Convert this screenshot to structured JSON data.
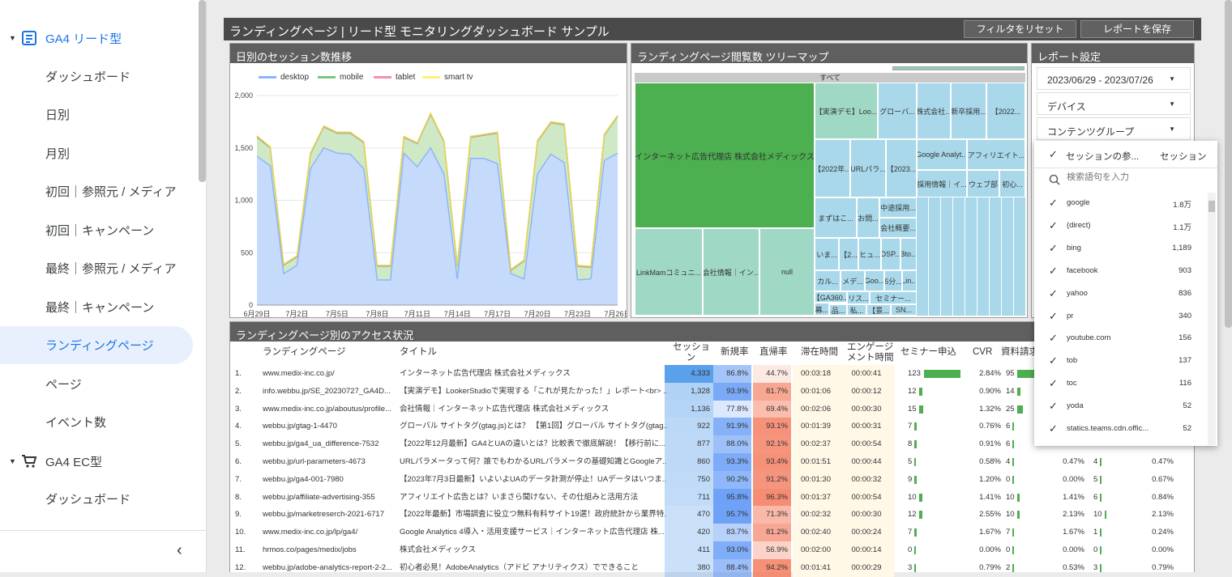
{
  "sidebar": {
    "group1": "GA4 リード型",
    "group2": "GA4 EC型",
    "items": [
      "ダッシュボード",
      "日別",
      "月別",
      "初回｜参照元 / メディア",
      "初回｜キャンペーン",
      "最終｜参照元 / メディア",
      "最終｜キャンペーン",
      "ランディングページ",
      "ページ",
      "イベント数"
    ],
    "items2": [
      "ダッシュボード"
    ]
  },
  "report": {
    "title": "ランディングページ | リード型 モニタリングダッシュボード サンプル",
    "reset_btn": "フィルタをリセット",
    "save_btn": "レポートを保存"
  },
  "line_panel": {
    "title": "日別のセッション数推移",
    "legend": [
      {
        "name": "desktop",
        "color": "#8ab4f8"
      },
      {
        "name": "mobile",
        "color": "#7bc67e"
      },
      {
        "name": "tablet",
        "color": "#f48fb1"
      },
      {
        "name": "smart tv",
        "color": "#fff176"
      }
    ]
  },
  "chart_data": {
    "type": "area",
    "x": [
      "6月29日",
      "6月30日",
      "7月1日",
      "7月2日",
      "7月3日",
      "7月4日",
      "7月5日",
      "7月6日",
      "7月7日",
      "7月8日",
      "7月9日",
      "7月10日",
      "7月11日",
      "7月12日",
      "7月13日",
      "7月14日",
      "7月15日",
      "7月16日",
      "7月17日",
      "7月18日",
      "7月19日",
      "7月20日",
      "7月21日",
      "7月22日",
      "7月23日",
      "7月24日",
      "7月25日",
      "7月26日"
    ],
    "xticks": [
      "6月29日",
      "7月2日",
      "7月5日",
      "7月8日",
      "7月11日",
      "7月14日",
      "7月17日",
      "7月20日",
      "7月23日",
      "7月26日"
    ],
    "yticks": [
      "0",
      "500",
      "1,000",
      "1,500",
      "2,000"
    ],
    "ylim": [
      0,
      2000
    ],
    "series": [
      {
        "name": "desktop",
        "values": [
          1420,
          1330,
          300,
          380,
          1300,
          1500,
          1450,
          1440,
          1300,
          240,
          240,
          1450,
          1320,
          1500,
          1250,
          250,
          1400,
          1400,
          1350,
          300,
          250,
          1250,
          1440,
          1360,
          240,
          250,
          1380,
          1450
        ]
      },
      {
        "name": "mobile",
        "values": [
          1600,
          1500,
          380,
          460,
          1440,
          1700,
          1640,
          1640,
          1550,
          370,
          370,
          1600,
          1540,
          1820,
          1560,
          370,
          1600,
          1620,
          1640,
          330,
          420,
          1560,
          1740,
          1720,
          370,
          360,
          1620,
          1800
        ]
      },
      {
        "name": "tablet",
        "values": [
          1610,
          1505,
          385,
          465,
          1445,
          1705,
          1645,
          1645,
          1555,
          375,
          375,
          1605,
          1545,
          1825,
          1565,
          375,
          1605,
          1625,
          1645,
          335,
          425,
          1565,
          1745,
          1725,
          375,
          365,
          1625,
          1805
        ]
      },
      {
        "name": "smart tv",
        "values": [
          1615,
          1510,
          390,
          470,
          1450,
          1710,
          1650,
          1650,
          1560,
          380,
          380,
          1610,
          1550,
          1830,
          1570,
          380,
          1610,
          1630,
          1650,
          340,
          430,
          1570,
          1750,
          1730,
          380,
          370,
          1630,
          1810
        ]
      }
    ]
  },
  "treemap": {
    "title": "ランディングページ閲覧数 ツリーマップ",
    "root": "すべて",
    "labels": {
      "big": "インターネット広告代理店 株式会社メディックス",
      "r1": "LinkMamコミュニ...",
      "r2": "会社情報｜イン...",
      "r3": "null",
      "a1": "【実演デモ】Loo...",
      "a2": "グローバ...",
      "a3": "株式会社...",
      "a4": "新卒採用...",
      "a5": "【2022...",
      "b1": "【2022年...",
      "b2": "URLパラ...",
      "b3": "【2023...",
      "b4": "Google Analyt...",
      "b5": "アフィリエイト...",
      "b6": "採用情報｜イ...",
      "b7": "ウェブ部",
      "b8": "初心...",
      "c1": "まずはこ...",
      "c2": "お問...",
      "c3": "中途採用...",
      "c4": "会社概要...",
      "c5": "いま...",
      "c6": "【2...",
      "c7": "ヒュ...",
      "c8": "DSP...",
      "c9": "Bto...",
      "c10": "カル...",
      "c11": "メデ...",
      "c12": "Goo...",
      "c13": "5分...",
      "c14": "Lin...",
      "c15": "【GA360...",
      "c16": "リス...",
      "c17": "セミナー...",
      "c18": "募...",
      "c19": "品...",
      "c20": "私...",
      "c21": "【景...",
      "c22": "SN..."
    }
  },
  "settings": {
    "title": "レポート設定",
    "date": "2023/06/29 - 2023/07/26",
    "device": "デバイス",
    "content_group": "コンテンツグループ"
  },
  "popup": {
    "col1": "セッションの参...",
    "col2": "セッション",
    "search_placeholder": "検索語句を入力",
    "rows": [
      {
        "name": "google",
        "value": "1.8万"
      },
      {
        "name": "(direct)",
        "value": "1.1万"
      },
      {
        "name": "bing",
        "value": "1,189"
      },
      {
        "name": "facebook",
        "value": "903"
      },
      {
        "name": "yahoo",
        "value": "836"
      },
      {
        "name": "pr",
        "value": "340"
      },
      {
        "name": "youtube.com",
        "value": "156"
      },
      {
        "name": "tob",
        "value": "137"
      },
      {
        "name": "toc",
        "value": "116"
      },
      {
        "name": "yoda",
        "value": "52"
      },
      {
        "name": "statics.teams.cdn.offic...",
        "value": "52"
      }
    ]
  },
  "table": {
    "title": "ランディングページ別のアクセス状況",
    "headers": {
      "lp": "ランディングページ",
      "title": "タイトル",
      "sessions": "セッショ\nン",
      "new": "新規率",
      "bounce": "直帰率",
      "stay": "滞在時間",
      "eng": "エンゲージ\nメント時間",
      "seminar": "セミナー申込",
      "cvr": "CVR",
      "doc": "資料請求"
    },
    "rows": [
      {
        "n": "1.",
        "lp": "www.medix-inc.co.jp/",
        "title": "インターネット広告代理店 株式会社メディックス",
        "s": "4,333",
        "nr": "86.8%",
        "br": "44.7%",
        "st": "00:03:18",
        "et": "00:00:41",
        "sem": "123",
        "cvr": "2.84%",
        "doc": "95",
        "x1": "",
        "x2": "",
        "x3": ""
      },
      {
        "n": "2.",
        "lp": "info.webbu.jp/SE_20230727_GA4D...",
        "title": "【実演デモ】LookerStudioで実現する「これが見たかった！」レポート<br> ...",
        "s": "1,328",
        "nr": "93.9%",
        "br": "81.7%",
        "st": "00:01:06",
        "et": "00:00:12",
        "sem": "12",
        "cvr": "0.90%",
        "doc": "14",
        "x1": "",
        "x2": "",
        "x3": ""
      },
      {
        "n": "3.",
        "lp": "www.medix-inc.co.jp/aboutus/profile...",
        "title": "会社情報｜インターネット広告代理店 株式会社メディックス",
        "s": "1,136",
        "nr": "77.8%",
        "br": "69.4%",
        "st": "00:02:06",
        "et": "00:00:30",
        "sem": "15",
        "cvr": "1.32%",
        "doc": "25",
        "x1": "",
        "x2": "",
        "x3": ""
      },
      {
        "n": "4.",
        "lp": "webbu.jp/gtag-1-4470",
        "title": "グローバル サイトタグ(gtag.js)とは？ 【第1回】グローバル サイトタグ(gtag...",
        "s": "922",
        "nr": "91.9%",
        "br": "93.1%",
        "st": "00:01:39",
        "et": "00:00:31",
        "sem": "7",
        "cvr": "0.76%",
        "doc": "6",
        "x1": "",
        "x2": "",
        "x3": ""
      },
      {
        "n": "5.",
        "lp": "webbu.jp/ga4_ua_difference-7532",
        "title": "【2022年12月最新】GA4とUAの違いとは？比較表で徹底解説！【移行前に...",
        "s": "877",
        "nr": "88.0%",
        "br": "92.1%",
        "st": "00:02:37",
        "et": "00:00:54",
        "sem": "8",
        "cvr": "0.91%",
        "doc": "6",
        "x1": "",
        "x2": "",
        "x3": ""
      },
      {
        "n": "6.",
        "lp": "webbu.jp/url-parameters-4673",
        "title": "URLパラメータって何？誰でもわかるURLパラメータの基礎知識とGoogleア...",
        "s": "860",
        "nr": "93.3%",
        "br": "93.4%",
        "st": "00:01:51",
        "et": "00:00:44",
        "sem": "5",
        "cvr": "0.58%",
        "doc": "4",
        "x1": "0.47%",
        "x2": "4",
        "x3": "0.47%"
      },
      {
        "n": "7.",
        "lp": "webbu.jp/ga4-001-7980",
        "title": "【2023年7月3日最新】いよいよUAのデータ計測が停止！UAデータはいつま...",
        "s": "750",
        "nr": "90.2%",
        "br": "91.2%",
        "st": "00:01:30",
        "et": "00:00:32",
        "sem": "9",
        "cvr": "1.20%",
        "doc": "0",
        "x1": "0.00%",
        "x2": "5",
        "x3": "0.67%"
      },
      {
        "n": "8.",
        "lp": "webbu.jp/affiliate-advertising-355",
        "title": "アフィリエイト広告とは？いまさら聞けない、その仕組みと活用方法",
        "s": "711",
        "nr": "95.8%",
        "br": "96.3%",
        "st": "00:01:37",
        "et": "00:00:54",
        "sem": "10",
        "cvr": "1.41%",
        "doc": "10",
        "x1": "1.41%",
        "x2": "6",
        "x3": "0.84%"
      },
      {
        "n": "9.",
        "lp": "webbu.jp/marketreserch-2021-6717",
        "title": "【2022年最新】市場調査に役立つ無料有料サイト19選！政府統計から業界特...",
        "s": "470",
        "nr": "95.7%",
        "br": "71.3%",
        "st": "00:02:32",
        "et": "00:00:30",
        "sem": "12",
        "cvr": "2.55%",
        "doc": "10",
        "x1": "2.13%",
        "x2": "10",
        "x3": "2.13%"
      },
      {
        "n": "10.",
        "lp": "www.medix-inc.co.jp/lp/ga4/",
        "title": "Google Analytics 4導入・活用支援サービス｜インターネット広告代理店 株...",
        "s": "420",
        "nr": "83.7%",
        "br": "81.2%",
        "st": "00:02:40",
        "et": "00:00:24",
        "sem": "7",
        "cvr": "1.67%",
        "doc": "7",
        "x1": "1.67%",
        "x2": "1",
        "x3": "0.24%"
      },
      {
        "n": "11.",
        "lp": "hrmos.co/pages/medix/jobs",
        "title": "株式会社メディックス",
        "s": "411",
        "nr": "93.0%",
        "br": "56.9%",
        "st": "00:02:00",
        "et": "00:00:14",
        "sem": "0",
        "cvr": "0.00%",
        "doc": "0",
        "x1": "0.00%",
        "x2": "0",
        "x3": "0.00%"
      },
      {
        "n": "12.",
        "lp": "webbu.jp/adobe-analytics-report-2-2...",
        "title": "初心者必見！AdobeAnalytics（アドビ アナリティクス）でできること",
        "s": "380",
        "nr": "88.4%",
        "br": "94.2%",
        "st": "00:01:41",
        "et": "00:00:29",
        "sem": "3",
        "cvr": "0.79%",
        "doc": "2",
        "x1": "0.53%",
        "x2": "3",
        "x3": "0.79%"
      }
    ]
  }
}
